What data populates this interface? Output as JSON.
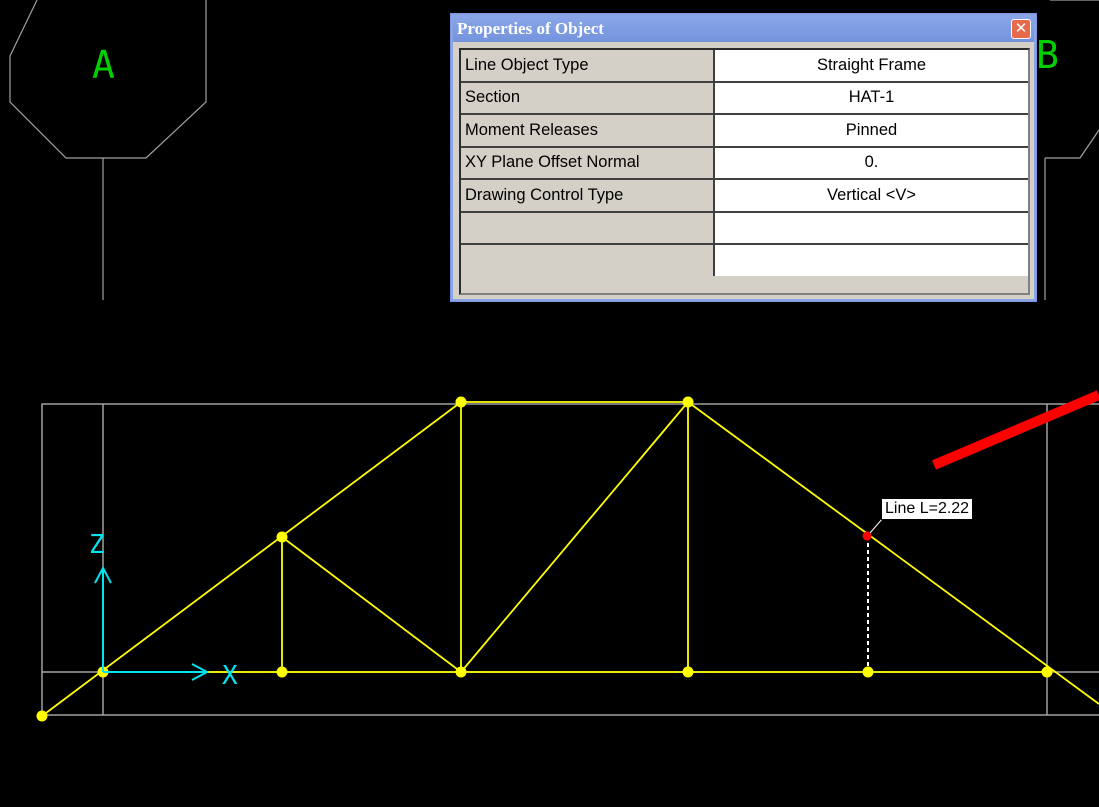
{
  "grid_labels": {
    "a": "A",
    "b": "B"
  },
  "axes": {
    "x": "X",
    "z": "Z"
  },
  "properties_window": {
    "title": "Properties of Object",
    "close_glyph": "✕",
    "rows": [
      {
        "key": "Line Object Type",
        "value": "Straight Frame"
      },
      {
        "key": "Section",
        "value": "HAT-1"
      },
      {
        "key": "Moment Releases",
        "value": "Pinned"
      },
      {
        "key": "XY Plane Offset Normal",
        "value": "0."
      },
      {
        "key": "Drawing Control Type",
        "value": "Vertical  <V>"
      },
      {
        "key": "",
        "value": ""
      },
      {
        "key": "",
        "value": ""
      }
    ]
  },
  "tooltip": {
    "text": "Line  L=2.22"
  },
  "colors": {
    "background": "#000000",
    "grid": "#a0a0a0",
    "truss": "#ffff00",
    "axes": "#00e5ee",
    "grid_label": "#00d000",
    "selected_point": "#ff0000",
    "arrow": "#ff0000"
  }
}
